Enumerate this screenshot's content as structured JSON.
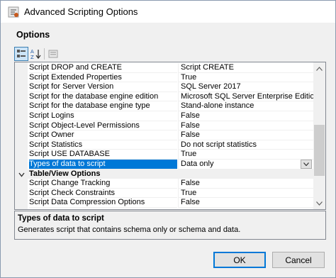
{
  "window": {
    "title": "Advanced Scripting Options",
    "section_label": "Options"
  },
  "toolbar": {
    "buttons": [
      {
        "icon": "categorized-icon",
        "active": true
      },
      {
        "icon": "alphabetical-sort-icon",
        "active": false
      },
      {
        "icon": "property-pages-icon",
        "active": false
      }
    ]
  },
  "grid": {
    "rows": [
      {
        "name": "Script DROP and CREATE",
        "value": "Script CREATE"
      },
      {
        "name": "Script Extended Properties",
        "value": "True"
      },
      {
        "name": "Script for Server Version",
        "value": "SQL Server 2017"
      },
      {
        "name": "Script for the database engine edition",
        "value": "Microsoft SQL Server Enterprise Edition"
      },
      {
        "name": "Script for the database engine type",
        "value": "Stand-alone instance"
      },
      {
        "name": "Script Logins",
        "value": "False"
      },
      {
        "name": "Script Object-Level Permissions",
        "value": "False"
      },
      {
        "name": "Script Owner",
        "value": "False"
      },
      {
        "name": "Script Statistics",
        "value": "Do not script statistics"
      },
      {
        "name": "Script USE DATABASE",
        "value": "True"
      },
      {
        "name": "Types of data to script",
        "value": "Data only",
        "selected": true
      },
      {
        "category": "Table/View Options"
      },
      {
        "name": "Script Change Tracking",
        "value": "False"
      },
      {
        "name": "Script Check Constraints",
        "value": "True"
      },
      {
        "name": "Script Data Compression Options",
        "value": "False"
      }
    ]
  },
  "description": {
    "title": "Types of data to script",
    "body": "Generates script that contains schema only or schema and data."
  },
  "buttons": {
    "ok": "OK",
    "cancel": "Cancel"
  },
  "colors": {
    "selection": "#0078d7",
    "window_bg": "#f0f0f0"
  }
}
